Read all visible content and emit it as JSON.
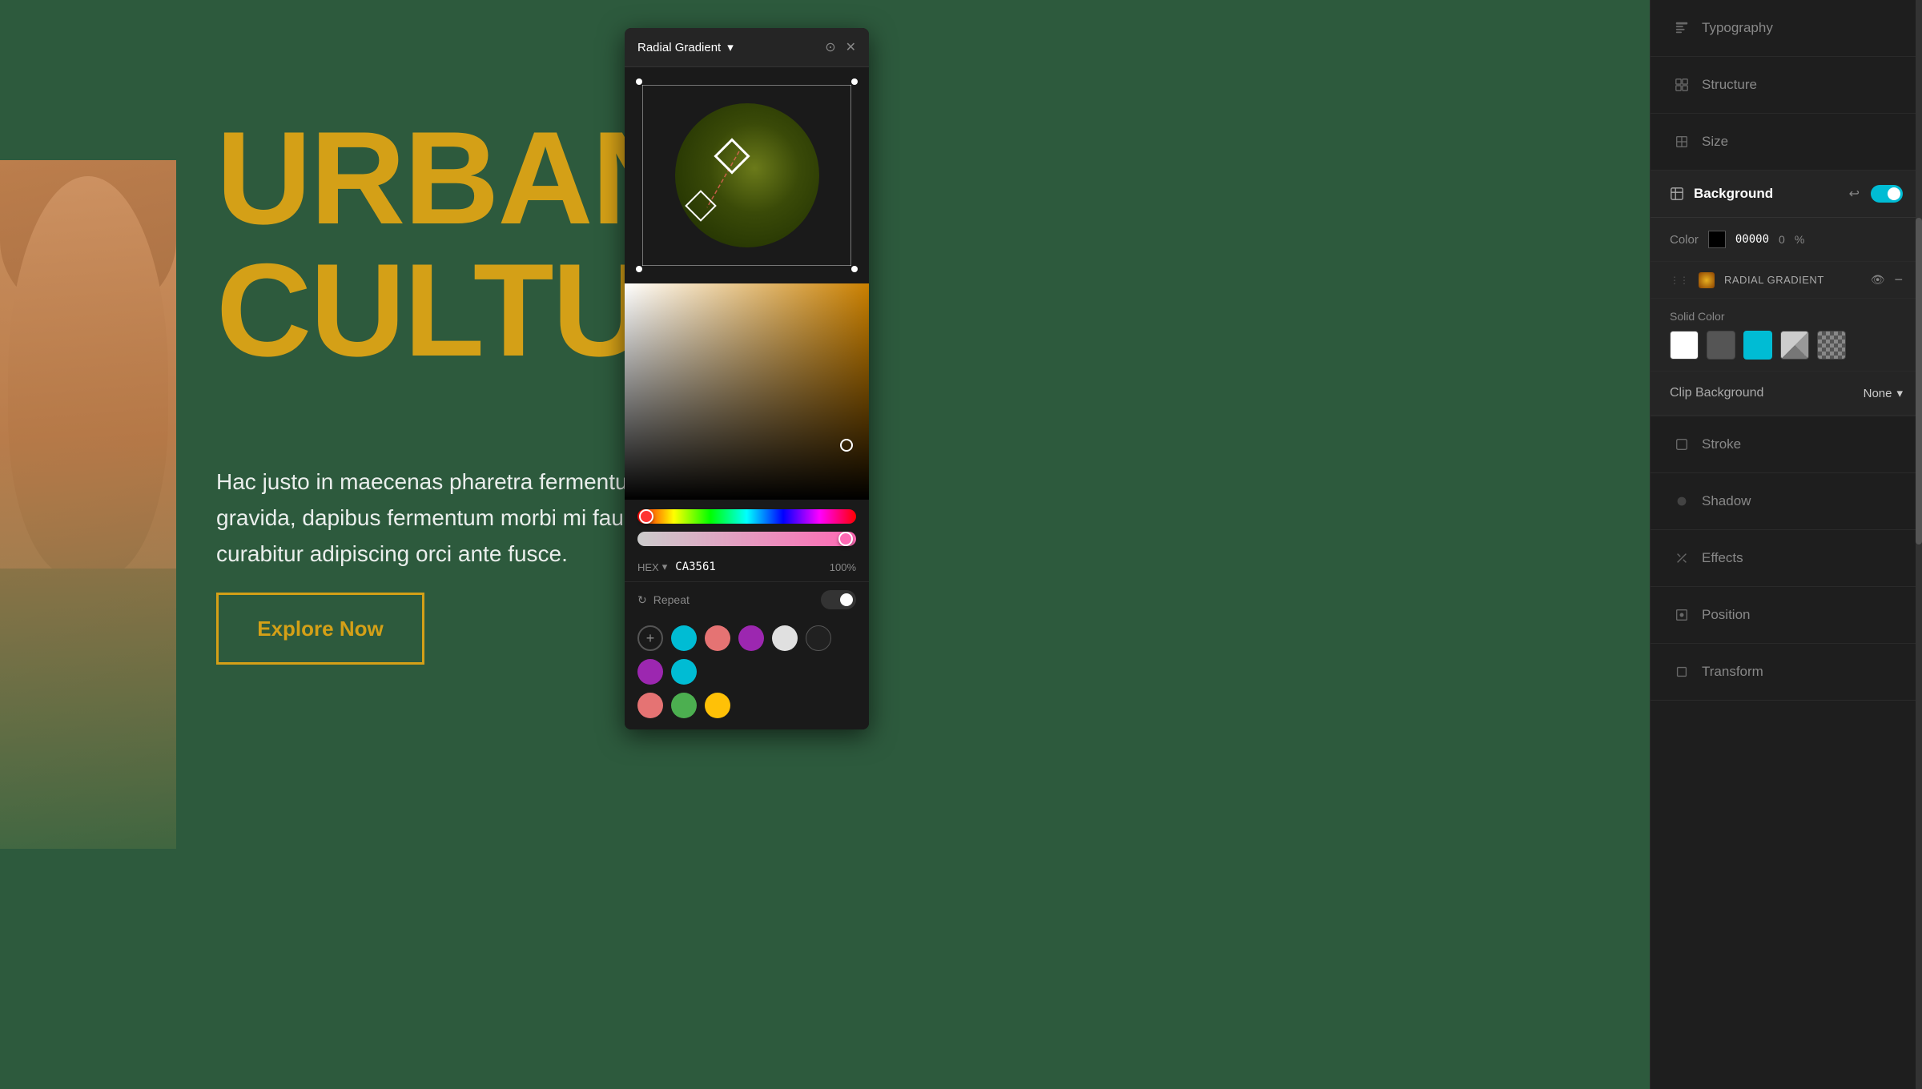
{
  "canvas": {
    "headline_line1": "URBAN",
    "headline_line2": "CULTURE",
    "body_text": "Hac justo in maecenas pharetra fermentum gravida, dapibus fermentum morbi mi faucibus curabitur adipiscing orci ante fusce.",
    "cta_label": "Explore Now"
  },
  "color_picker": {
    "title": "Radial Gradient",
    "hex_label": "HEX",
    "hex_value": "CA3561",
    "opacity_value": "100%",
    "repeat_label": "Repeat"
  },
  "right_panel": {
    "typography_label": "Typography",
    "structure_label": "Structure",
    "size_label": "Size",
    "background_label": "Background",
    "color_label": "Color",
    "color_hex": "00000",
    "color_num": "0",
    "color_percent": "%",
    "gradient_layer_label": "RADIAL GRADIENT",
    "solid_color_label": "Solid Color",
    "clip_background_label": "Clip Background",
    "clip_background_value": "None",
    "stroke_label": "Stroke",
    "shadow_label": "Shadow",
    "effects_label": "Effects",
    "position_label": "Position",
    "transform_label": "Transform"
  },
  "swatches": {
    "row1": [
      "#00bcd4",
      "#e57373",
      "#9c27b0",
      "#e0e0e0",
      "#212121",
      "#9c27b0",
      "#00bcd4"
    ],
    "row2": [
      "#e57373",
      "#4caf50",
      "#ffc107"
    ]
  }
}
